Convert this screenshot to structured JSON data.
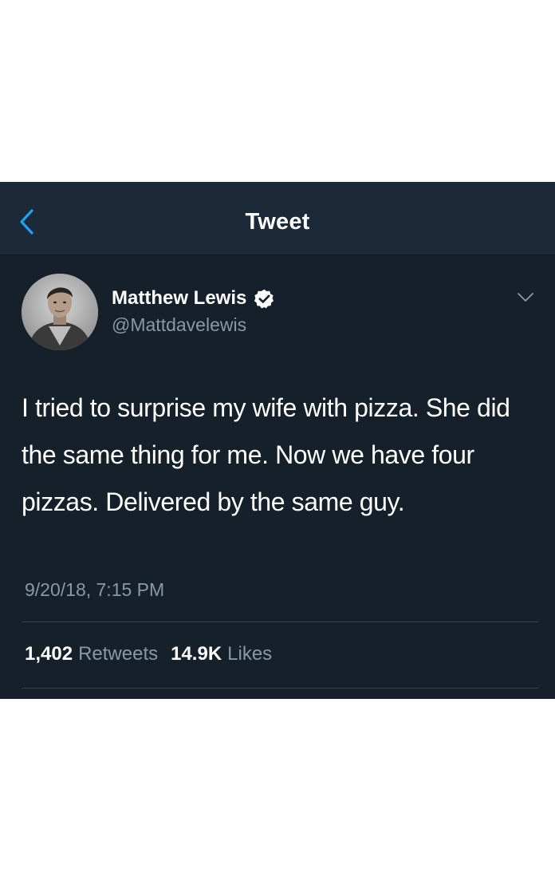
{
  "colors": {
    "background": "#15202b",
    "navbar": "#1c2938",
    "accent": "#1da1f2",
    "secondary_text": "#8899a6",
    "divider": "#38444d"
  },
  "nav": {
    "title": "Tweet",
    "back_icon": "chevron-left-icon"
  },
  "tweet": {
    "author": {
      "name": "Matthew Lewis",
      "handle": "@Mattdavelewis",
      "verified": true,
      "verified_icon": "verified-badge-icon",
      "avatar_icon": "avatar-photo"
    },
    "menu_icon": "chevron-down-icon",
    "text": "I tried to surprise my wife with pizza. She did the same thing for me. Now we have four pizzas. Delivered by the same guy.",
    "timestamp": "9/20/18, 7:15 PM",
    "stats": {
      "retweets_count": "1,402",
      "retweets_label": "Retweets",
      "likes_count": "14.9K",
      "likes_label": "Likes"
    }
  }
}
